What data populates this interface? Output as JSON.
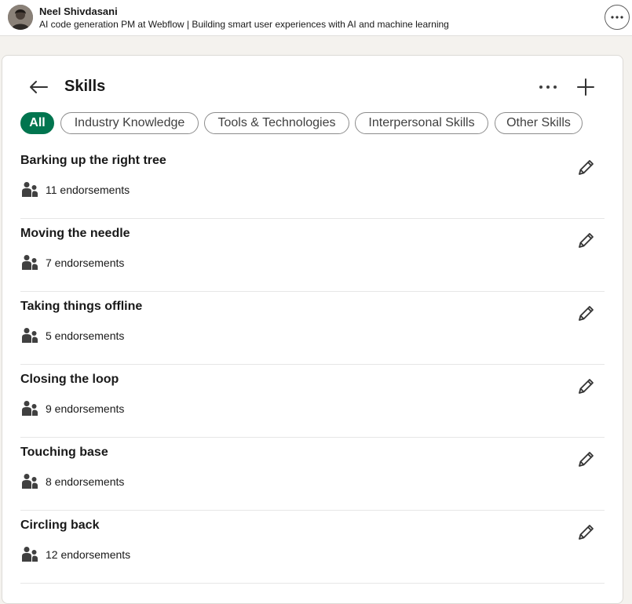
{
  "profile": {
    "name": "Neel Shivdasani",
    "headline": "AI code generation PM at Webflow | Building smart user experiences with AI and machine learning"
  },
  "page": {
    "title": "Skills"
  },
  "icons": {
    "back": "arrow-left-icon",
    "more": "ellipsis-icon",
    "add": "plus-icon",
    "edit": "pencil-icon",
    "endorsements": "people-icon"
  },
  "colors": {
    "accent": "#01754f"
  },
  "filters": [
    {
      "label": "All",
      "active": true
    },
    {
      "label": "Industry Knowledge",
      "active": false
    },
    {
      "label": "Tools & Technologies",
      "active": false
    },
    {
      "label": "Interpersonal Skills",
      "active": false
    },
    {
      "label": "Other Skills",
      "active": false
    }
  ],
  "skills": [
    {
      "name": "Barking up the right tree",
      "endorsements": "11 endorsements"
    },
    {
      "name": "Moving the needle",
      "endorsements": "7 endorsements"
    },
    {
      "name": "Taking things offline",
      "endorsements": "5 endorsements"
    },
    {
      "name": "Closing the loop",
      "endorsements": "9 endorsements"
    },
    {
      "name": "Touching base",
      "endorsements": "8 endorsements"
    },
    {
      "name": "Circling back",
      "endorsements": "12 endorsements"
    }
  ]
}
